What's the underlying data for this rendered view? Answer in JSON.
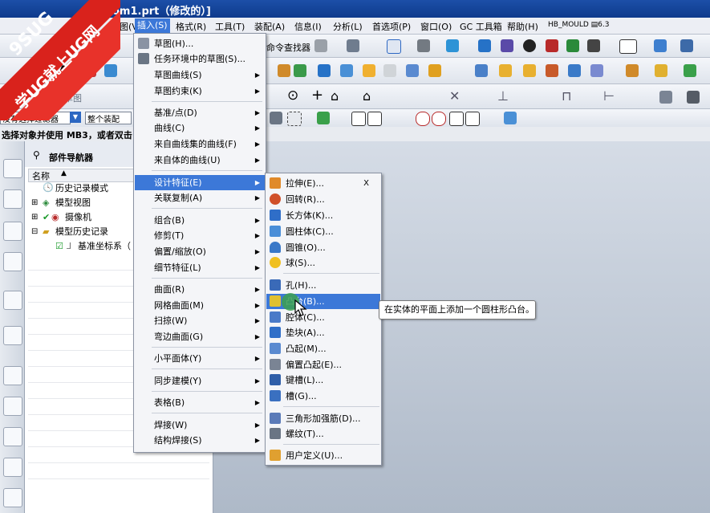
{
  "window": {
    "title": "om1.prt（修改的）]"
  },
  "menubar": {
    "items": [
      "视图(V)",
      "插入(S)",
      "格式(R)",
      "工具(T)",
      "装配(A)",
      "信息(I)",
      "分析(L)",
      "首选项(P)",
      "窗口(O)",
      "GC 工具箱",
      "帮助(H)",
      "HB_MOULD ▤6.3"
    ]
  },
  "toolbar": {
    "command_finder": "命令查找器",
    "finish_sketch": "完成草图",
    "filter": "没有选择过滤器",
    "assembly": "整个装配"
  },
  "status": {
    "text": "选择对象并使用 MB3，或者双击"
  },
  "navigator": {
    "title": "部件导航器",
    "column": "名称",
    "rows": [
      "历史记录模式",
      "模型视图",
      "摄像机",
      "模型历史记录",
      "基准坐标系（"
    ]
  },
  "insert_menu": {
    "items": [
      "草图(H)...",
      "任务环境中的草图(S)...",
      "草图曲线(S)",
      "草图约束(K)",
      "基准/点(D)",
      "曲线(C)",
      "来自曲线集的曲线(F)",
      "来自体的曲线(U)",
      "设计特征(E)",
      "关联复制(A)",
      "组合(B)",
      "修剪(T)",
      "偏置/缩放(O)",
      "细节特征(L)",
      "曲面(R)",
      "网格曲面(M)",
      "扫掠(W)",
      "弯边曲面(G)",
      "小平面体(Y)",
      "同步建模(Y)",
      "表格(B)",
      "焊接(W)",
      "结构焊接(S)"
    ]
  },
  "design_menu": {
    "shortcut": "X",
    "items": [
      "拉伸(E)...",
      "回转(R)...",
      "长方体(K)...",
      "圆柱体(C)...",
      "圆锥(O)...",
      "球(S)...",
      "孔(H)...",
      "凸台(B)...",
      "腔体(C)...",
      "垫块(A)...",
      "凸起(M)...",
      "偏置凸起(E)...",
      "键槽(L)...",
      "槽(G)...",
      "三角形加强筋(D)...",
      "螺纹(T)...",
      "用户定义(U)..."
    ]
  },
  "tooltip": "在实体的平面上添加一个圆柱形凸台。",
  "watermark": {
    "line1": "9SUG",
    "line2": "学UG就上UG网"
  },
  "colors": {
    "highlight": "#3c78d8",
    "watermark": "#d9221c",
    "menu_bg": "#f4f5f8"
  }
}
